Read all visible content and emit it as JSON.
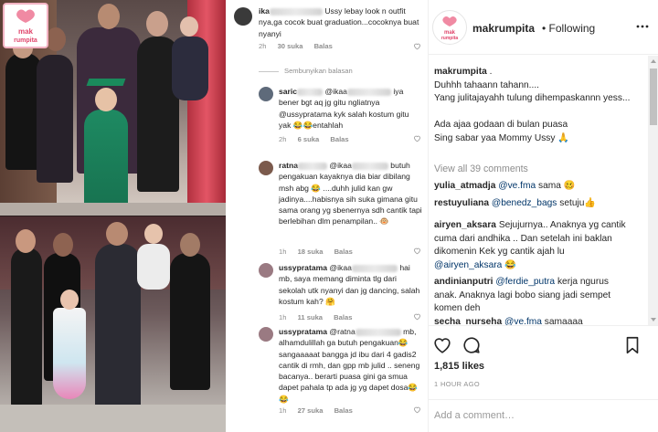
{
  "images": {
    "brand_logo_text": "makrumpita"
  },
  "comment_thread": {
    "top_comment": {
      "user": "ika",
      "text_tail": "Ussy lebay look n outfit nya,ga cocok buat graduation...cocoknya buat nyanyi",
      "time": "2h",
      "likes": "30 suka",
      "reply": "Balas"
    },
    "hide_replies": "Sembunyikan balasan",
    "replies": [
      {
        "user": "saric",
        "mention": "@ikaa",
        "text_tail": "iya bener bgt aq jg gitu ngliatnya @ussypratama kyk salah kostum gitu yak 😂😂entahlah",
        "time": "2h",
        "likes": "6 suka",
        "reply": "Balas"
      },
      {
        "user": "ratna",
        "mention": "@ikaa",
        "text": "butuh pengakuan kayaknya dia biar dibilang msh abg 😂 ....duhh julid kan gw jadinya....habisnya sih suka gimana gitu sama orang yg sbenernya sdh cantik tapi berlebihan dlm penampilan.. 🐵",
        "time": "1h",
        "likes": "18 suka",
        "reply": "Balas"
      },
      {
        "user": "ussypratama",
        "mention": "@ikaa",
        "text": "hai mb, saya memang diminta tlg dari sekolah utk nyanyi dan jg dancing, salah kostum kah? 🤗",
        "time": "1h",
        "likes": "11 suka",
        "reply": "Balas"
      },
      {
        "user": "ussypratama",
        "mention": "@ratna",
        "text": "mb, alhamdulillah ga butuh pengakuan😂 sangaaaaat bangga jd ibu dari 4 gadis2 cantik di rmh, dan gpp mb julid .. seneng bacanya.. berarti puasa gini ga smua dapet pahala tp ada jg yg dapet dosa😂😂",
        "time": "1h",
        "likes": "27 suka",
        "reply": "Balas"
      }
    ]
  },
  "post": {
    "username": "makrumpita",
    "follow_status": "• Following",
    "caption": {
      "user": "makrumpita",
      "lines": [
        ".",
        "Duhhh tahaann tahann....",
        "Yang julitajayahh tulung dihempaskannn yess...",
        "",
        "Ada ajaa godaan di bulan puasa",
        "Sing sabar yaa Mommy Ussy 🙏"
      ]
    },
    "view_all": "View all 39 comments",
    "comments": [
      {
        "user": "yulia_atmadja",
        "mention": "@ve.fma",
        "text": "sama 🥴"
      },
      {
        "user": "restuyuliana",
        "mention": "@benedz_bags",
        "text": "setuju👍"
      },
      {
        "user": "airyen_aksara",
        "text": "Sejujurnya.. Anaknya yg cantik cuma dari andhika .. Dan setelah ini baklan dikomenin Kek yg cantik ajah lu",
        "mention_after": "@airyen_aksara",
        "emoji": "😂"
      },
      {
        "user": "andinianputri",
        "mention": "@ferdie_putra",
        "text": "kerja ngurus anak. Anaknya lagi bobo siang jadi sempet komen deh"
      },
      {
        "user": "secha_nurseha",
        "mention": "@ve.fma",
        "text": "samaaaa"
      }
    ],
    "likes": "1,815 likes",
    "timestamp": "1 HOUR AGO",
    "add_comment_placeholder": "Add a comment…"
  }
}
